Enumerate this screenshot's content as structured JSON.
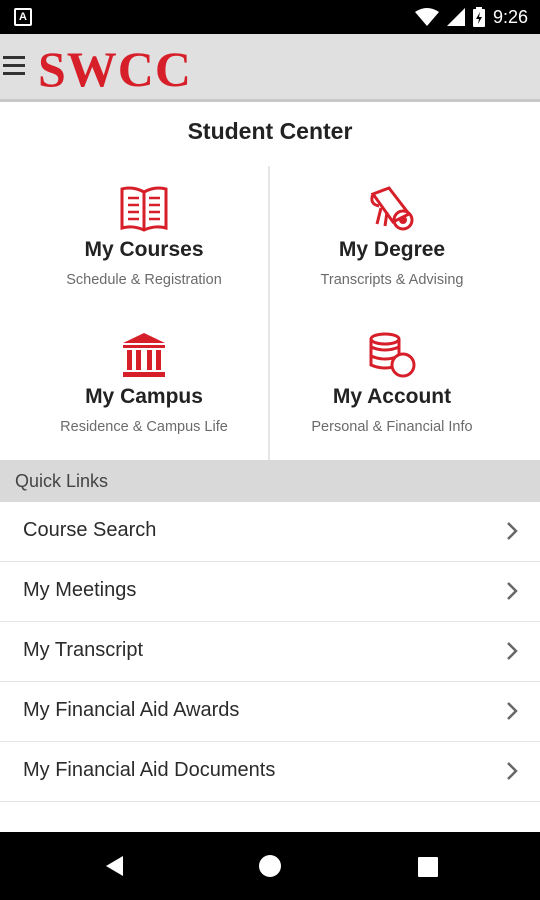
{
  "status_bar": {
    "notification_icon": "A",
    "time": "9:26",
    "icons": [
      "wifi-icon",
      "signal-icon",
      "battery-icon"
    ]
  },
  "app_bar": {
    "logo_text": "SWCC",
    "menu_icon": "hamburger-menu-icon"
  },
  "colors": {
    "brand_red": "#d71f2a",
    "appbar_bg": "#e0e0e0",
    "section_header_bg": "#d9d9d9"
  },
  "page": {
    "title": "Student Center"
  },
  "tiles": [
    {
      "title": "My Courses",
      "subtitle": "Schedule & Registration",
      "icon": "book-icon"
    },
    {
      "title": "My Degree",
      "subtitle": "Transcripts & Advising",
      "icon": "diploma-icon"
    },
    {
      "title": "My Campus",
      "subtitle": "Residence & Campus Life",
      "icon": "building-icon"
    },
    {
      "title": "My Account",
      "subtitle": "Personal & Financial Info",
      "icon": "coins-icon"
    }
  ],
  "quick_links": {
    "header": "Quick Links",
    "items": [
      {
        "label": "Course Search"
      },
      {
        "label": "My Meetings"
      },
      {
        "label": "My Transcript"
      },
      {
        "label": "My Financial Aid Awards"
      },
      {
        "label": "My Financial Aid Documents"
      }
    ]
  },
  "nav_bar": {
    "buttons": [
      "back-icon",
      "home-icon",
      "recents-icon"
    ]
  }
}
